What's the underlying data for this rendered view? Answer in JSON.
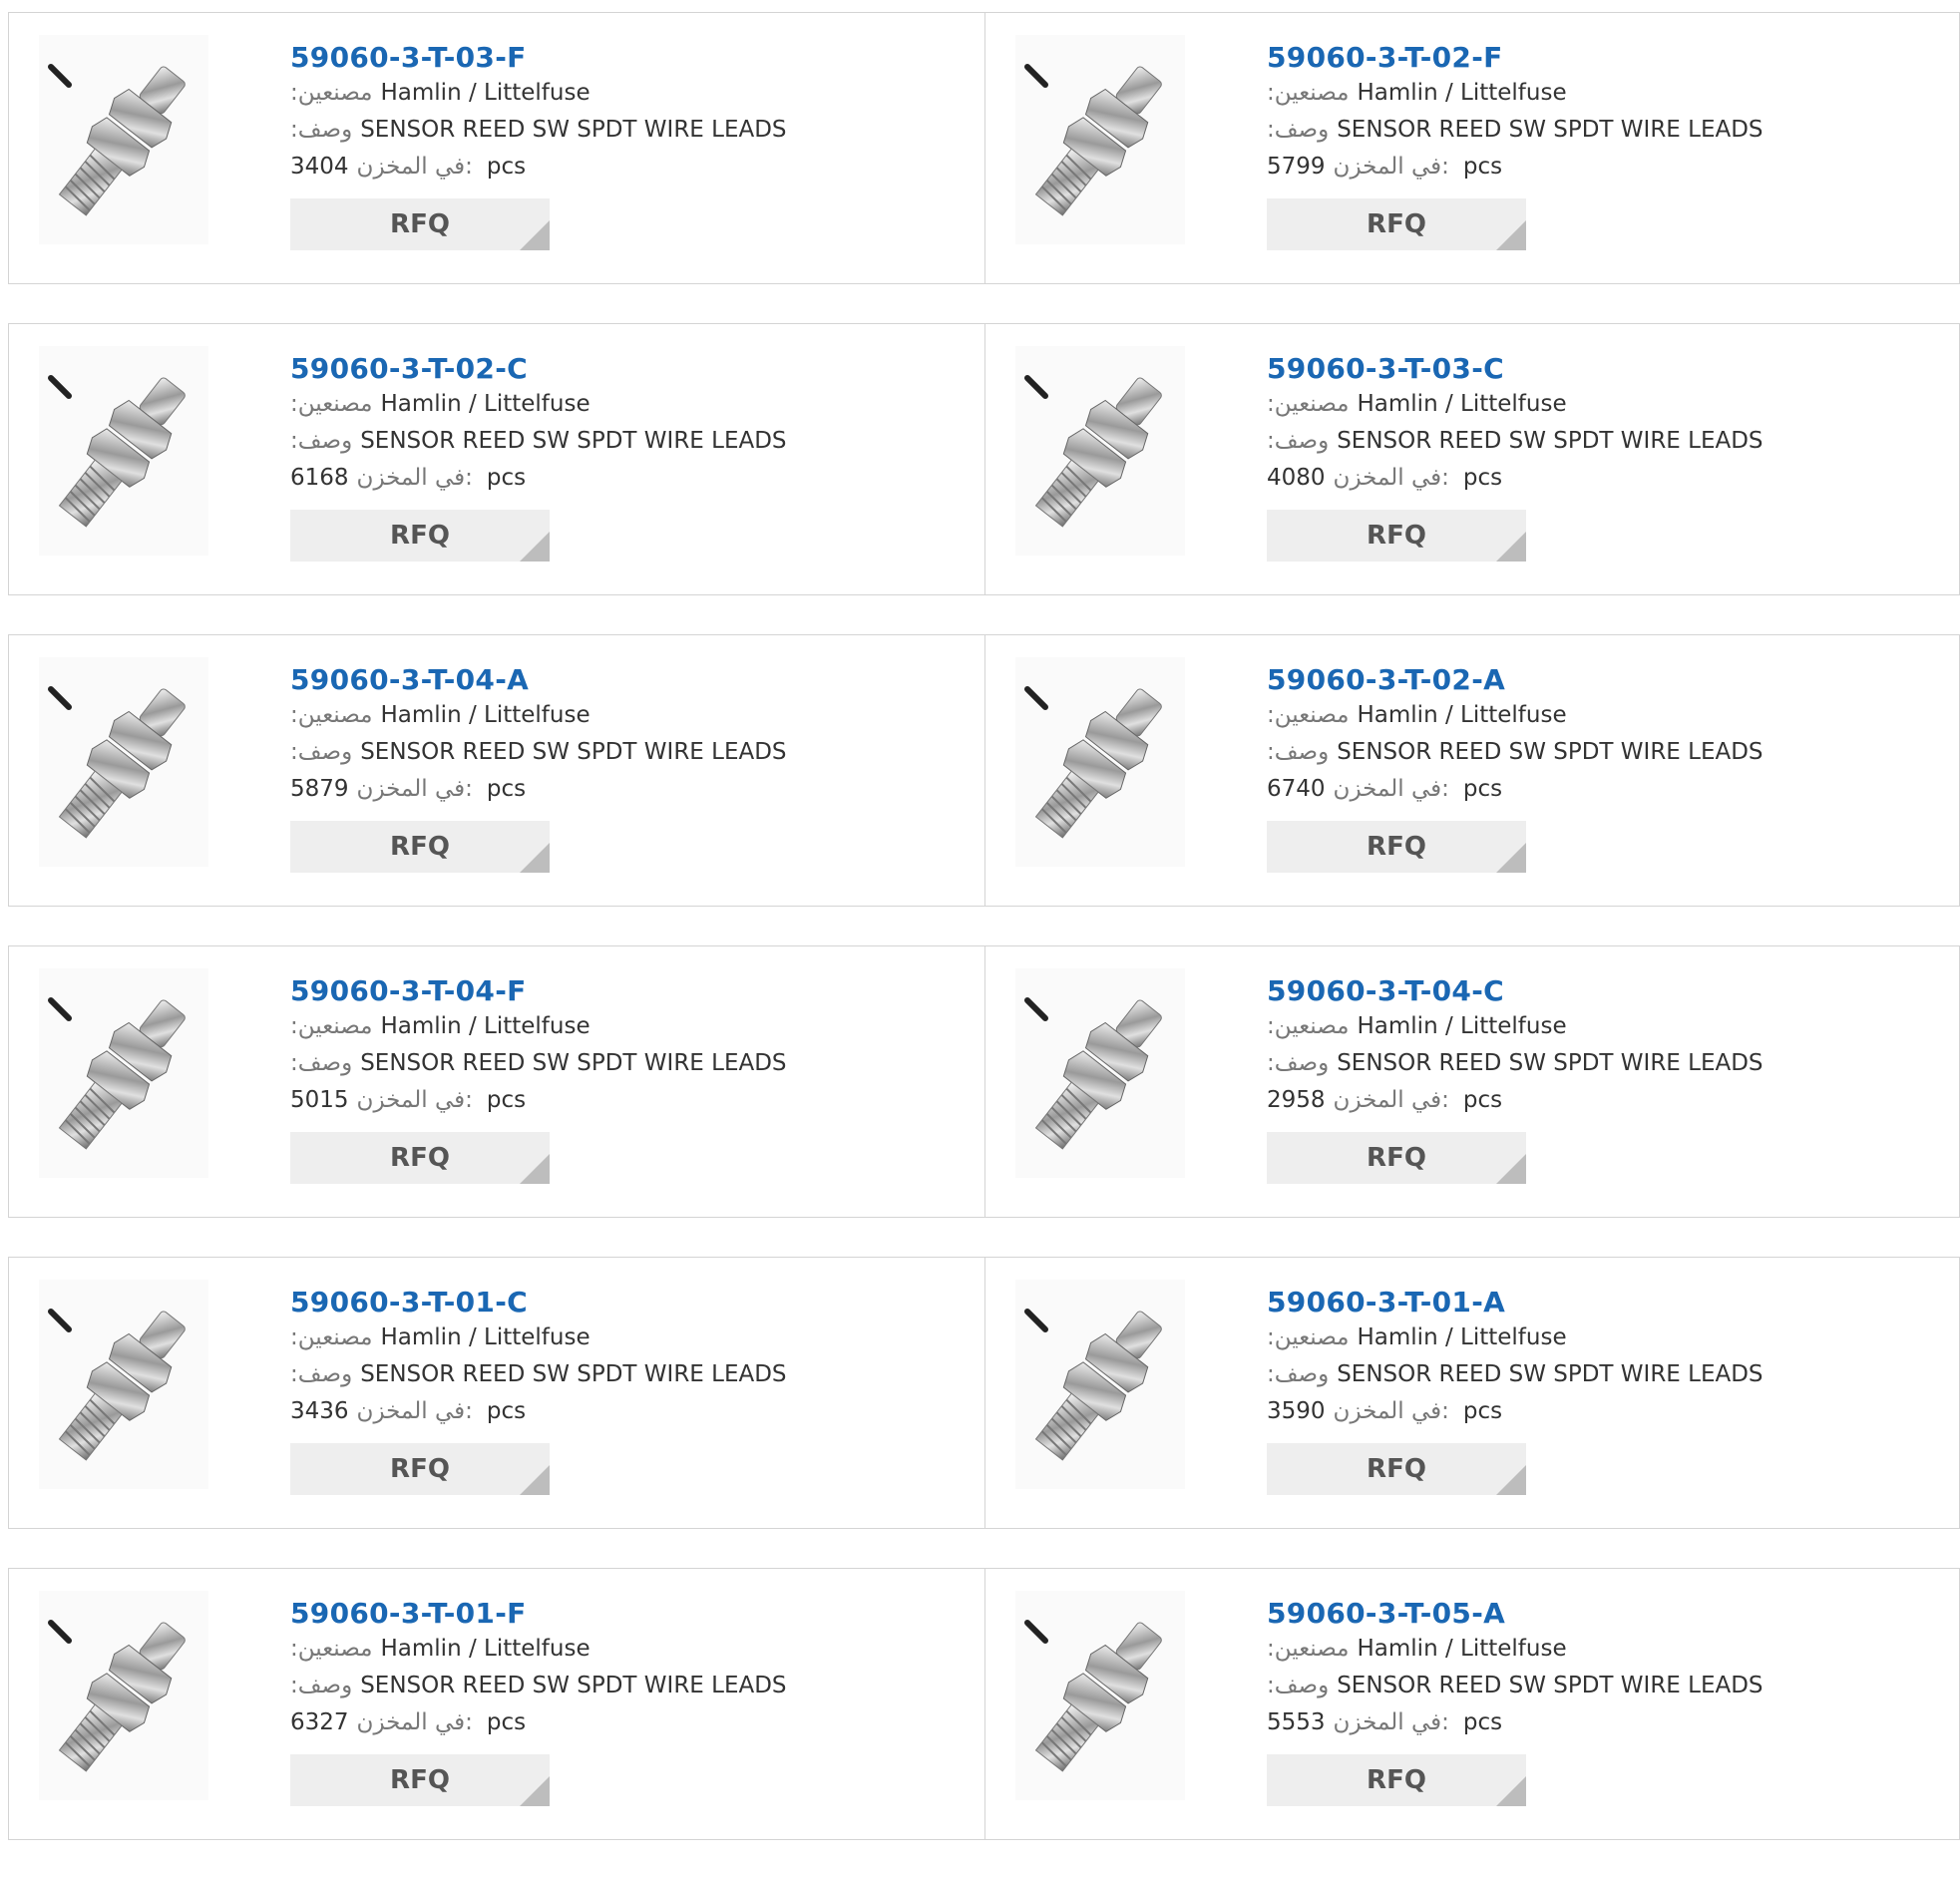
{
  "labels": {
    "manufacturer": ":مصنعين",
    "description": ":وصف",
    "stock": "في المخزن:",
    "unit": "pcs",
    "rfq": "RFQ"
  },
  "products": [
    {
      "part": "59060-3-T-03-F",
      "manufacturer": "Hamlin / Littelfuse",
      "description": "SENSOR REED SW SPDT WIRE LEADS",
      "stock": "3404",
      "icon": "reed-sensor-image"
    },
    {
      "part": "59060-3-T-02-F",
      "manufacturer": "Hamlin / Littelfuse",
      "description": "SENSOR REED SW SPDT WIRE LEADS",
      "stock": "5799",
      "icon": "reed-sensor-image"
    },
    {
      "part": "59060-3-T-02-C",
      "manufacturer": "Hamlin / Littelfuse",
      "description": "SENSOR REED SW SPDT WIRE LEADS",
      "stock": "6168",
      "icon": "reed-sensor-image"
    },
    {
      "part": "59060-3-T-03-C",
      "manufacturer": "Hamlin / Littelfuse",
      "description": "SENSOR REED SW SPDT WIRE LEADS",
      "stock": "4080",
      "icon": "reed-sensor-image"
    },
    {
      "part": "59060-3-T-04-A",
      "manufacturer": "Hamlin / Littelfuse",
      "description": "SENSOR REED SW SPDT WIRE LEADS",
      "stock": "5879",
      "icon": "reed-sensor-image"
    },
    {
      "part": "59060-3-T-02-A",
      "manufacturer": "Hamlin / Littelfuse",
      "description": "SENSOR REED SW SPDT WIRE LEADS",
      "stock": "6740",
      "icon": "reed-sensor-image"
    },
    {
      "part": "59060-3-T-04-F",
      "manufacturer": "Hamlin / Littelfuse",
      "description": "SENSOR REED SW SPDT WIRE LEADS",
      "stock": "5015",
      "icon": "reed-sensor-image"
    },
    {
      "part": "59060-3-T-04-C",
      "manufacturer": "Hamlin / Littelfuse",
      "description": "SENSOR REED SW SPDT WIRE LEADS",
      "stock": "2958",
      "icon": "reed-sensor-image"
    },
    {
      "part": "59060-3-T-01-C",
      "manufacturer": "Hamlin / Littelfuse",
      "description": "SENSOR REED SW SPDT WIRE LEADS",
      "stock": "3436",
      "icon": "reed-sensor-image"
    },
    {
      "part": "59060-3-T-01-A",
      "manufacturer": "Hamlin / Littelfuse",
      "description": "SENSOR REED SW SPDT WIRE LEADS",
      "stock": "3590",
      "icon": "reed-sensor-image"
    },
    {
      "part": "59060-3-T-01-F",
      "manufacturer": "Hamlin / Littelfuse",
      "description": "SENSOR REED SW SPDT WIRE LEADS",
      "stock": "6327",
      "icon": "reed-sensor-image"
    },
    {
      "part": "59060-3-T-05-A",
      "manufacturer": "Hamlin / Littelfuse",
      "description": "SENSOR REED SW SPDT WIRE LEADS",
      "stock": "5553",
      "icon": "reed-sensor-image"
    }
  ],
  "colors": {
    "part_link": "#1a67b3",
    "border": "#d4d4d4",
    "rfq_bg": "#eeeeee",
    "rfq_corner": "#bdbdbd"
  }
}
